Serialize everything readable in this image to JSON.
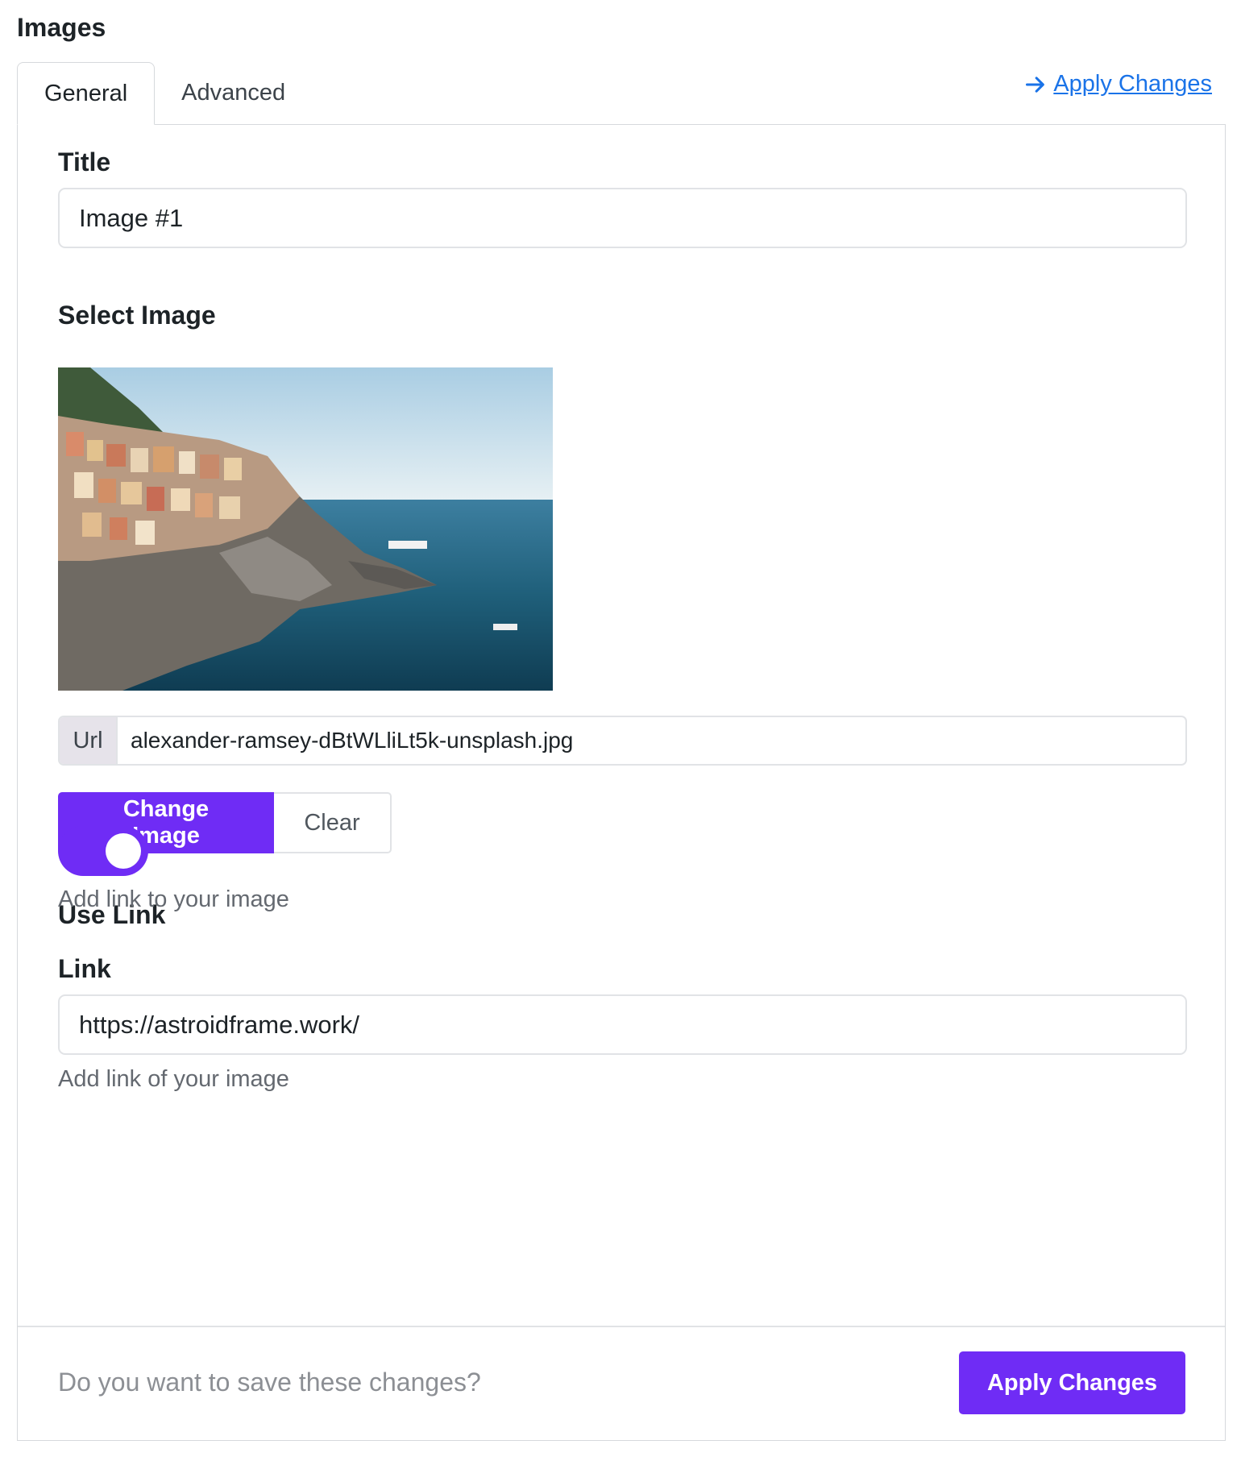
{
  "header": {
    "title": "Images"
  },
  "tabs": [
    {
      "label": "General",
      "active": true
    },
    {
      "label": "Advanced",
      "active": false
    }
  ],
  "top_action": {
    "label": "Apply Changes",
    "icon": "arrow-right-icon"
  },
  "form": {
    "title": {
      "label": "Title",
      "value": "Image #1"
    },
    "select_image": {
      "label": "Select Image",
      "url_addon": "Url",
      "url_value": "alexander-ramsey-dBtWLliLt5k-unsplash.jpg",
      "change_label": "Change Image",
      "clear_label": "Clear"
    },
    "use_link": {
      "label": "Use Link",
      "enabled": true,
      "help": "Add link to your image"
    },
    "link": {
      "label": "Link",
      "value": "https://astroidframe.work/",
      "help": "Add link of your image"
    }
  },
  "footer": {
    "prompt": "Do you want to save these changes?",
    "apply_label": "Apply Changes"
  },
  "colors": {
    "accent": "#6f2cf5",
    "link": "#1a73e8",
    "border": "#e1e3e6"
  }
}
